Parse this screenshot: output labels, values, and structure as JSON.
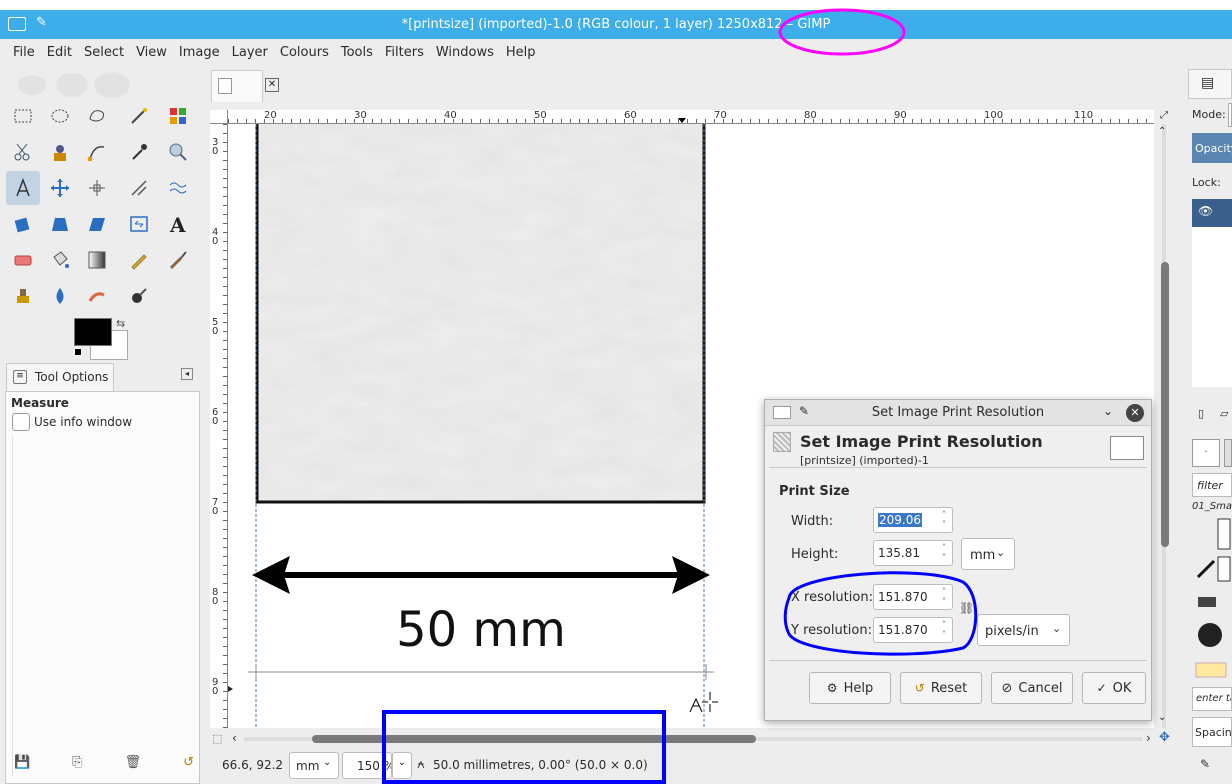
{
  "window": {
    "title": "*[printsize] (imported)-1.0 (RGB colour, 1 layer) 1250x812 – GIMP"
  },
  "menu": [
    "File",
    "Edit",
    "Select",
    "View",
    "Image",
    "Layer",
    "Colours",
    "Tools",
    "Filters",
    "Windows",
    "Help"
  ],
  "tools": [
    "rect-select",
    "ellipse-select",
    "free-select",
    "fuzzy-select",
    "by-colour-select",
    "scissors-select",
    "foreground-select",
    "paths",
    "colour-picker",
    "zoom",
    "measure",
    "move",
    "align",
    "transform",
    "warp",
    "rotate",
    "perspective",
    "shear",
    "flip",
    "text",
    "eraser",
    "bucket-fill",
    "gradient",
    "pencil",
    "paintbrush",
    "clone",
    "ink",
    "smudge",
    "airbrush"
  ],
  "tool_options": {
    "tab_label": "Tool Options",
    "tool_name": "Measure",
    "checkbox_label": "Use info window"
  },
  "rulers": {
    "top": [
      "20",
      "30",
      "40",
      "50",
      "60",
      "70",
      "80",
      "90",
      "100",
      "110"
    ],
    "left": [
      "30",
      "40",
      "50",
      "60",
      "70",
      "80",
      "90"
    ]
  },
  "canvas_image": {
    "label": "50 mm"
  },
  "dialog": {
    "title": "Set Image Print Resolution",
    "heading": "Set Image Print Resolution",
    "subheading": "[printsize] (imported)-1",
    "section": "Print Size",
    "width_label": "Width:",
    "width_value": "209.06",
    "height_label": "Height:",
    "height_value": "135.81",
    "unit": "mm",
    "xres_label": "X resolution:",
    "xres_value": "151.870",
    "yres_label": "Y resolution:",
    "yres_value": "151.870",
    "res_unit": "pixels/in",
    "buttons": {
      "help": "Help",
      "reset": "Reset",
      "cancel": "Cancel",
      "ok": "OK"
    }
  },
  "status": {
    "coords": "66.6, 92.2",
    "unit": "mm",
    "zoom": "150 %",
    "message": "50.0 millimetres, 0.00° (50.0 × 0.0)"
  },
  "right_panel": {
    "mode_label": "Mode:",
    "opacity_label": "Opacity",
    "lock_label": "Lock:",
    "filter_label": "filter",
    "brush_name": "01_Smal",
    "enter_tag": "enter ta",
    "spacing_label": "Spacing"
  },
  "colors": {
    "titlebar": "#3daee9",
    "annotation_magenta": "#ff00ff",
    "annotation_blue": "#0000ff"
  }
}
